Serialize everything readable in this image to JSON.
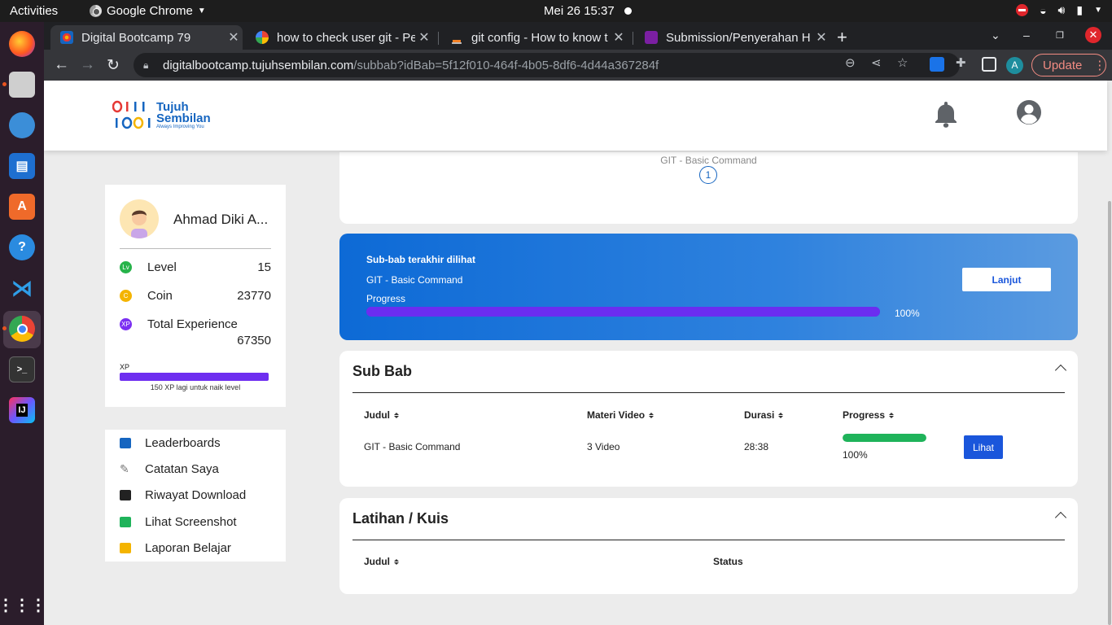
{
  "os": {
    "activities": "Activities",
    "app_name": "Google Chrome",
    "clock": "Mei 26  15:37"
  },
  "browser": {
    "tabs": [
      {
        "title": "Digital Bootcamp 79",
        "active": true
      },
      {
        "title": "how to check user git - Pe",
        "active": false
      },
      {
        "title": "git config - How to know t",
        "active": false
      },
      {
        "title": "Submission/Penyerahan H",
        "active": false
      }
    ],
    "url_host": "digitalbootcamp.tujuhsembilan.com",
    "url_path": "/subbab?idBab=5f12f010-464f-4b05-8df6-4d44a367284f",
    "profile_initial": "A",
    "update_label": "Update"
  },
  "site": {
    "logo_line1": "Tujuh",
    "logo_line2": "Sembilan",
    "logo_tagline": "Always Improving You"
  },
  "profile": {
    "name": "Ahmad Diki A...",
    "stats": [
      {
        "icon": "Lv",
        "label": "Level",
        "value": "15",
        "color": "#27b34a"
      },
      {
        "icon": "C",
        "label": "Coin",
        "value": "23770",
        "color": "#f4b400"
      },
      {
        "icon": "XP",
        "label": "Total Experience",
        "value": "67350",
        "color": "#7b2ff2"
      }
    ],
    "xp_label": "XP",
    "xp_hint": "150 XP lagi untuk naik level"
  },
  "menu": [
    {
      "label": "Leaderboards",
      "icon": "chart-icon",
      "color": "#1565c0"
    },
    {
      "label": "Catatan Saya",
      "icon": "pencil-icon",
      "color": "#777777"
    },
    {
      "label": "Riwayat Download",
      "icon": "folder-icon",
      "color": "#222222"
    },
    {
      "label": "Lihat Screenshot",
      "icon": "camera-icon",
      "color": "#1fb35a"
    },
    {
      "label": "Laporan Belajar",
      "icon": "clipboard-icon",
      "color": "#f4b400"
    }
  ],
  "top_card": {
    "faded_title": "GIT - Basic Command",
    "step": "1"
  },
  "last_seen": {
    "heading": "Sub-bab terakhir dilihat",
    "subbab": "GIT - Basic Command",
    "progress_label": "Progress",
    "progress_value": 1.0,
    "progress_text": "100%",
    "button": "Lanjut"
  },
  "sub_bab": {
    "title": "Sub Bab",
    "columns": [
      "Judul",
      "Materi Video",
      "Durasi",
      "Progress"
    ],
    "rows": [
      {
        "judul": "GIT - Basic Command",
        "materi": "3 Video",
        "durasi": "28:38",
        "progress_value": 1.0,
        "progress_text": "100%",
        "action": "Lihat"
      }
    ]
  },
  "latihan": {
    "title": "Latihan / Kuis",
    "columns": [
      "Judul",
      "Status"
    ]
  }
}
